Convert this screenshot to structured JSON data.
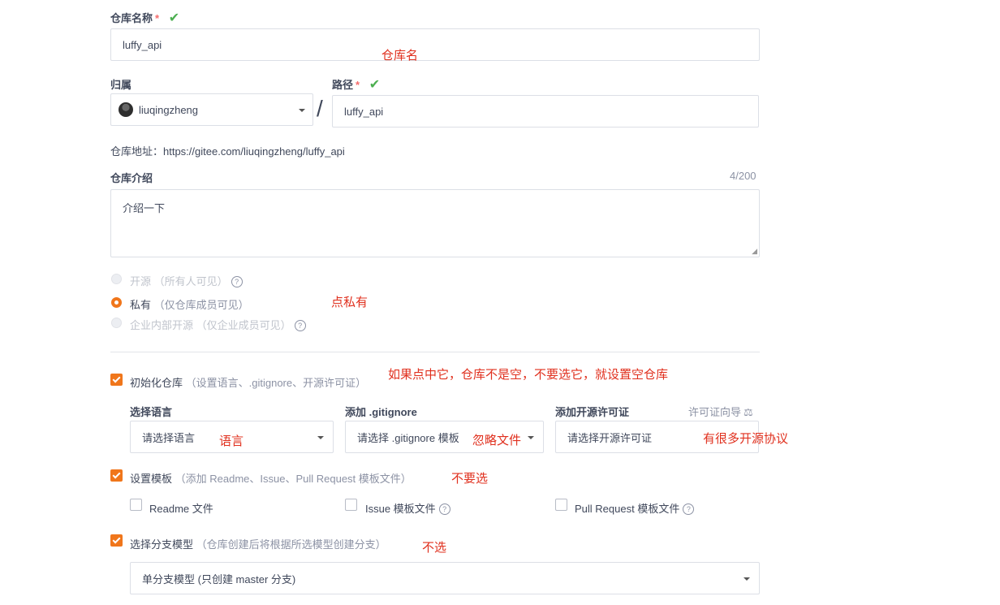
{
  "repo_name": {
    "label": "仓库名称",
    "required_mark": "*",
    "value": "luffy_api"
  },
  "owner": {
    "label": "归属",
    "value": "liuqingzheng"
  },
  "separator": "/",
  "path": {
    "label": "路径",
    "required_mark": "*",
    "value": "luffy_api"
  },
  "repo_address": "仓库地址：https://gitee.com/liuqingzheng/luffy_api",
  "intro": {
    "label": "仓库介绍",
    "counter": "4/200",
    "value": "介绍一下"
  },
  "visibility": [
    {
      "label": "开源",
      "hint": "（所有人可见）",
      "state": "disabled",
      "help": true
    },
    {
      "label": "私有",
      "hint": "（仅仓库成员可见）",
      "state": "selected",
      "help": false
    },
    {
      "label": "企业内部开源",
      "hint": "（仅企业成员可见）",
      "state": "disabled",
      "help": true
    }
  ],
  "init_repo": {
    "label": "初始化仓库",
    "hint": "（设置语言、.gitignore、开源许可证）",
    "checked": true
  },
  "language": {
    "label": "选择语言",
    "placeholder": "请选择语言"
  },
  "gitignore": {
    "label": "添加 .gitignore",
    "placeholder": "请选择 .gitignore 模板"
  },
  "license": {
    "label": "添加开源许可证",
    "placeholder": "请选择开源许可证",
    "wizard": "许可证向导"
  },
  "template": {
    "label": "设置模板",
    "hint": "（添加 Readme、Issue、Pull Request 模板文件）",
    "checked": true
  },
  "template_files": [
    {
      "label": "Readme 文件",
      "checked": false
    },
    {
      "label": "Issue 模板文件",
      "checked": false
    },
    {
      "label": "Pull Request 模板文件",
      "checked": false
    }
  ],
  "branch_model": {
    "label": "选择分支模型",
    "hint": "（仓库创建后将根据所选模型创建分支）",
    "checked": true,
    "value": "单分支模型 (只创建 master 分支)"
  },
  "annotations": {
    "repo_name": "仓库名",
    "private": "点私有",
    "init": "如果点中它，仓库不是空，不要选它，就设置空仓库",
    "language": "语言",
    "gitignore": "忽略文件",
    "license": "有很多开源协议",
    "template": "不要选",
    "branch": "不选"
  },
  "colors": {
    "accent": "#f0761b",
    "annotation": "#e0301e",
    "check": "#4caf50"
  }
}
